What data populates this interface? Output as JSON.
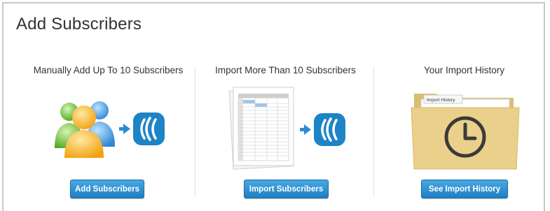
{
  "page": {
    "title": "Add Subscribers"
  },
  "sections": [
    {
      "heading": "Manually Add Up To 10 Subscribers",
      "button": "Add Subscribers"
    },
    {
      "heading": "Import More Than 10 Subscribers",
      "button": "Import Subscribers"
    },
    {
      "heading": "Your Import History",
      "button": "See Import History",
      "folder_tab_label": "Import History"
    }
  ],
  "colors": {
    "button": "#2589cc",
    "brand_blue": "#1d84c6",
    "folder": "#ead08a",
    "panel_border": "#c8c8c8"
  },
  "icons": [
    "users-icon",
    "arrow-right-icon",
    "brand-logo-icon",
    "spreadsheet-icon",
    "folder-icon",
    "clock-icon"
  ]
}
